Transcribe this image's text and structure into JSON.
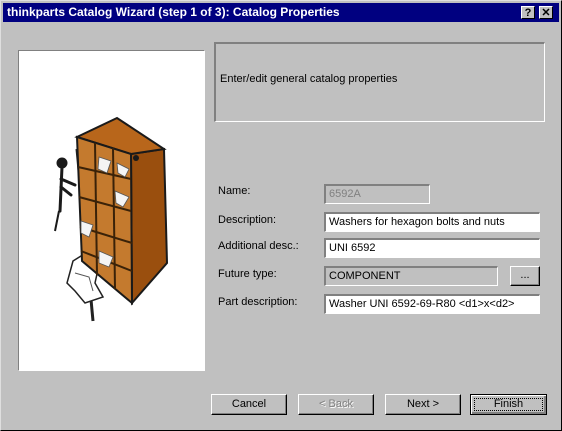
{
  "window": {
    "title": "thinkparts Catalog Wizard (step 1 of 3): Catalog Properties",
    "help_label": "?",
    "close_label": "✕"
  },
  "info": {
    "text": "Enter/edit general catalog properties"
  },
  "form": {
    "name_label": "Name:",
    "name_value": "6592A",
    "description_label": "Description:",
    "description_value": "Washers for hexagon bolts and nuts",
    "additional_label": "Additional desc.:",
    "additional_value": "UNI 6592",
    "future_type_label": "Future type:",
    "future_type_value": "COMPONENT",
    "browse_label": "...",
    "part_description_label": "Part description:",
    "part_description_value": "Washer UNI 6592-69-R80 <d1>x<d2>"
  },
  "buttons": {
    "cancel": "Cancel",
    "back": "< Back",
    "next": "Next >",
    "finish": "Finish"
  },
  "illustration": {
    "icon": "bookshelf-illustration-icon"
  }
}
